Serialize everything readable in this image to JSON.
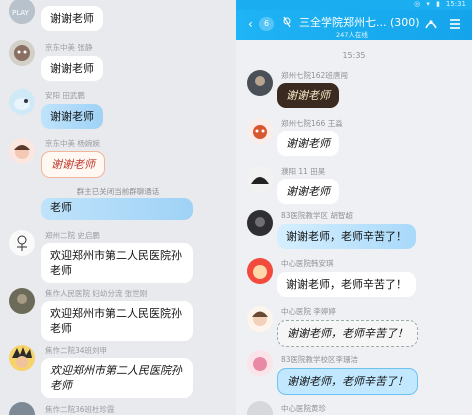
{
  "left_pane": {
    "messages": [
      {
        "sender": "",
        "text": "谢谢老师",
        "avatar": "avatar-play-icon"
      },
      {
        "sender": "京东中美 张静",
        "text": "谢谢老师",
        "avatar": "avatar-cartoon-icon"
      },
      {
        "sender": "安阳 田武鹏",
        "text": "谢谢老师",
        "avatar": "avatar-bird-icon"
      },
      {
        "sender": "京东中美 杨婉婉",
        "text": "谢谢老师",
        "avatar": "avatar-girl-icon"
      },
      {
        "sender": "",
        "text": "老师",
        "avatar": ""
      },
      {
        "sender": "郑州二院 史启鹏",
        "text": "欢迎郑州市第二人民医院孙老师",
        "avatar": "avatar-sketch-icon"
      },
      {
        "sender": "焦作人民医院 妇幼分流 张世刚",
        "text": "欢迎郑州市第二人民医院孙老师",
        "avatar": "avatar-photo-icon"
      },
      {
        "sender": "焦作二院34班刘甲",
        "text": "欢迎郑州市第二人民医院孙老师",
        "avatar": "avatar-anime-icon"
      },
      {
        "sender": "焦作二院36班杜珍霞",
        "text": "",
        "avatar": "avatar-photo2-icon"
      }
    ],
    "system_notice": "群主已关闭当前群聊通话"
  },
  "right_pane": {
    "status_bar": {
      "icons": "◎ ▾ ▮",
      "time": "15:31"
    },
    "header": {
      "back": "‹",
      "unread": "6",
      "title": "三全学院郑州七... (300)",
      "subtitle": "247人在线"
    },
    "timestamp": "15:35",
    "messages": [
      {
        "sender": "郑州七院162班唐闯",
        "text": "谢谢老师"
      },
      {
        "sender": "郑州七院166 王淼",
        "text": "谢谢老师"
      },
      {
        "sender": "濮阳 11 田昊",
        "text": "谢谢老师"
      },
      {
        "sender": "83医院教学区 胡智超",
        "text": "谢谢老师，老师辛苦了！"
      },
      {
        "sender": "中心医院韩安琪",
        "text": "谢谢老师，老师辛苦了！"
      },
      {
        "sender": "中心医院 李婷婷",
        "text": "谢谢老师，老师辛苦了！"
      },
      {
        "sender": "83医院教学校区李珊洁",
        "text": "谢谢老师，老师辛苦了！"
      },
      {
        "sender": "中心医院黄珍",
        "text": ""
      }
    ]
  }
}
